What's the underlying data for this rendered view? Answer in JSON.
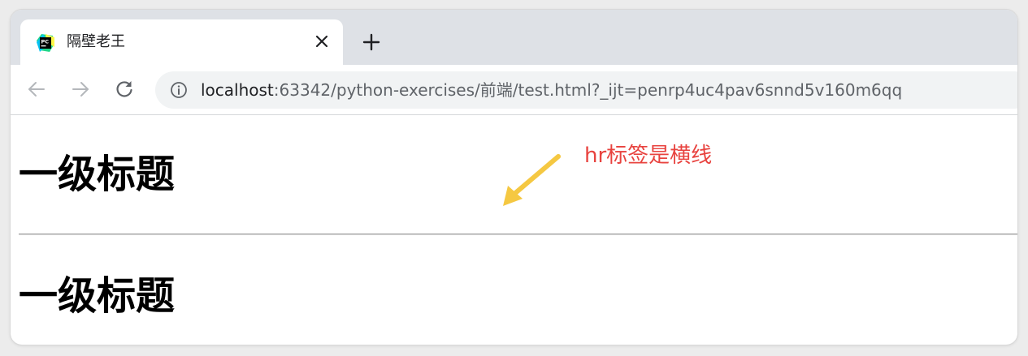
{
  "tab": {
    "title": "隔壁老王",
    "favicon": "pycharm-icon",
    "close": "close-icon"
  },
  "new_tab": "plus-icon",
  "nav": {
    "back": "back-arrow-icon",
    "forward": "forward-arrow-icon",
    "reload": "reload-icon",
    "info": "info-icon"
  },
  "url": {
    "host": "localhost",
    "rest": ":63342/python-exercises/前端/test.html?_ijt=penrp4uc4pav6snnd5v160m6qq"
  },
  "page": {
    "heading1": "一级标题",
    "heading2": "一级标题"
  },
  "annotation": {
    "text": "hr标签是横线",
    "text_color": "#e8433f",
    "arrow_color": "#f5c842"
  }
}
